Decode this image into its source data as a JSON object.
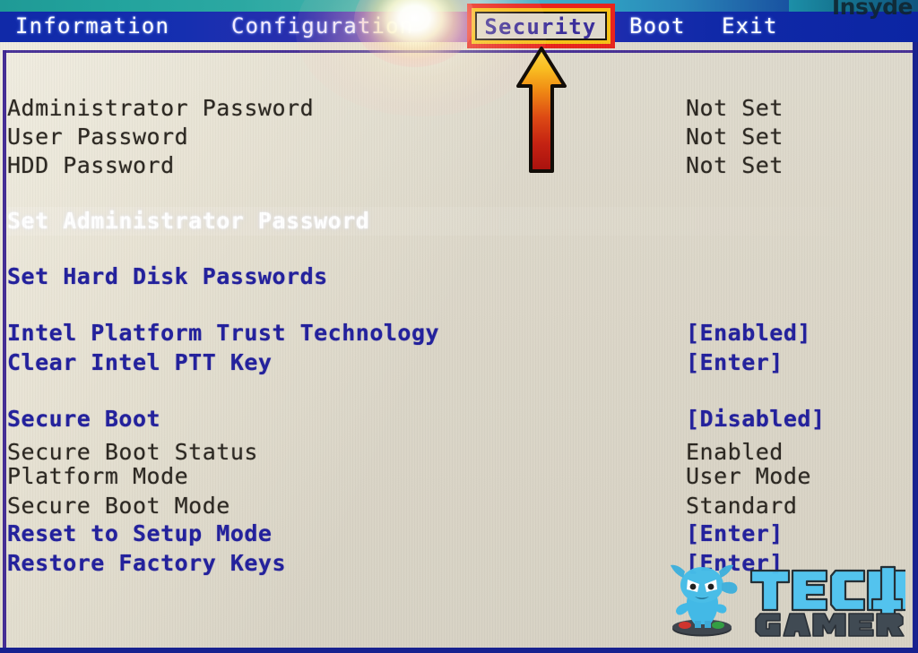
{
  "brand": {
    "vendor_logo_text": "Insyde",
    "watermark_line1": "TECH",
    "watermark_digit": "4",
    "watermark_line2": "GAMERS"
  },
  "menubar": {
    "items": [
      {
        "label": "Information",
        "active": false
      },
      {
        "label": "Configuration",
        "active": false
      },
      {
        "label": "Security",
        "active": true
      },
      {
        "label": "Boot",
        "active": false
      },
      {
        "label": "Exit",
        "active": false
      }
    ]
  },
  "annotation": {
    "highlight_target": "Security",
    "box_color": "#e8241c",
    "box_inner_color": "#f6c117",
    "arrow_color_top": "#f7b51d",
    "arrow_color_bottom": "#b81410"
  },
  "colors": {
    "panel_bg": "#dcd7c9",
    "menubar_bg": "#1029a8",
    "text_dark": "#2b2721",
    "text_blue": "#22209c",
    "text_selected": "#ffffff",
    "frame_purple": "#3a2290",
    "accent_cyan": "#4fc3f0"
  },
  "settings": {
    "rows": [
      {
        "label": "Administrator Password",
        "value": "Not Set",
        "label_style": "dark",
        "value_style": "dark"
      },
      {
        "label": "User Password",
        "value": "Not Set",
        "label_style": "dark",
        "value_style": "dark"
      },
      {
        "label": "HDD Password",
        "value": "Not Set",
        "label_style": "dark",
        "value_style": "dark"
      },
      {
        "label": "Set Administrator Password",
        "value": "",
        "label_style": "white",
        "value_style": "white"
      },
      {
        "label": "Set Hard Disk Passwords",
        "value": "",
        "label_style": "blue",
        "value_style": "blue"
      },
      {
        "label": "Intel Platform Trust Technology",
        "value": "[Enabled]",
        "label_style": "blue",
        "value_style": "blue"
      },
      {
        "label": "Clear Intel PTT Key",
        "value": "[Enter]",
        "label_style": "blue",
        "value_style": "blue"
      },
      {
        "label": "Secure Boot",
        "value": "[Disabled]",
        "label_style": "blue",
        "value_style": "blue"
      },
      {
        "label": "Secure Boot Status",
        "value": "Enabled",
        "label_style": "dark",
        "value_style": "dark"
      },
      {
        "label": "Platform Mode",
        "value": "User Mode",
        "label_style": "dark",
        "value_style": "dark"
      },
      {
        "label": "Secure Boot Mode",
        "value": "Standard",
        "label_style": "dark",
        "value_style": "dark"
      },
      {
        "label": "Reset to Setup Mode",
        "value": "[Enter]",
        "label_style": "blue",
        "value_style": "blue"
      },
      {
        "label": "Restore Factory Keys",
        "value": "[Enter]",
        "label_style": "blue",
        "value_style": "blue"
      }
    ]
  }
}
